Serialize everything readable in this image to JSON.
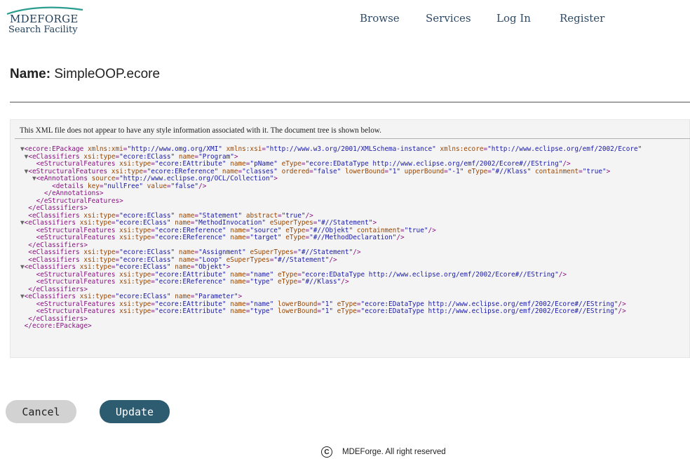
{
  "header": {
    "logo_top": "MDEFORGE",
    "logo_bottom": "Search Facility",
    "nav": [
      {
        "label": "Browse"
      },
      {
        "label": "Services"
      },
      {
        "label": "Log In"
      },
      {
        "label": "Register"
      }
    ]
  },
  "page": {
    "name_label": "Name:",
    "name_value": "SimpleOOP.ecore"
  },
  "xml_viewer": {
    "info": "This XML file does not appear to have any style information associated with it. The document tree is shown below.",
    "lines": [
      {
        "tw": "▼",
        "tok": [
          [
            "tg",
            "<ecore:EPackage "
          ],
          [
            "an",
            "xmlns:xmi"
          ],
          [
            "tg",
            "="
          ],
          [
            "av",
            "\"http://www.omg.org/XMI\""
          ],
          [
            "tg",
            " "
          ],
          [
            "an",
            "xmlns:xsi"
          ],
          [
            "tg",
            "="
          ],
          [
            "av",
            "\"http://www.w3.org/2001/XMLSchema-instance\""
          ],
          [
            "tg",
            " "
          ],
          [
            "an",
            "xmlns:ecore"
          ],
          [
            "tg",
            "="
          ],
          [
            "av",
            "\"http://www.eclipse.org/emf/2002/Ecore\""
          ]
        ]
      },
      {
        "indent": 1,
        "tw": "▼",
        "tok": [
          [
            "tg",
            "<eClassifiers "
          ],
          [
            "an",
            "xsi:type"
          ],
          [
            "tg",
            "="
          ],
          [
            "av",
            "\"ecore:EClass\""
          ],
          [
            "tg",
            " "
          ],
          [
            "an",
            "name"
          ],
          [
            "tg",
            "="
          ],
          [
            "av",
            "\"Program\""
          ],
          [
            "tg",
            ">"
          ]
        ]
      },
      {
        "indent": 2,
        "tok": [
          [
            "tg",
            "<eStructuralFeatures "
          ],
          [
            "an",
            "xsi:type"
          ],
          [
            "tg",
            "="
          ],
          [
            "av",
            "\"ecore:EAttribute\""
          ],
          [
            "tg",
            " "
          ],
          [
            "an",
            "name"
          ],
          [
            "tg",
            "="
          ],
          [
            "av",
            "\"pName\""
          ],
          [
            "tg",
            " "
          ],
          [
            "an",
            "eType"
          ],
          [
            "tg",
            "="
          ],
          [
            "av",
            "\"ecore:EDataType http://www.eclipse.org/emf/2002/Ecore#//EString\""
          ],
          [
            "tg",
            "/>"
          ]
        ]
      },
      {
        "indent": 1,
        "tw": "▼",
        "tok": [
          [
            "tg",
            "<eStructuralFeatures "
          ],
          [
            "an",
            "xsi:type"
          ],
          [
            "tg",
            "="
          ],
          [
            "av",
            "\"ecore:EReference\""
          ],
          [
            "tg",
            " "
          ],
          [
            "an",
            "name"
          ],
          [
            "tg",
            "="
          ],
          [
            "av",
            "\"classes\""
          ],
          [
            "tg",
            " "
          ],
          [
            "an",
            "ordered"
          ],
          [
            "tg",
            "="
          ],
          [
            "av",
            "\"false\""
          ],
          [
            "tg",
            " "
          ],
          [
            "an",
            "lowerBound"
          ],
          [
            "tg",
            "="
          ],
          [
            "av",
            "\"1\""
          ],
          [
            "tg",
            " "
          ],
          [
            "an",
            "upperBound"
          ],
          [
            "tg",
            "="
          ],
          [
            "av",
            "\"-1\""
          ],
          [
            "tg",
            " "
          ],
          [
            "an",
            "eType"
          ],
          [
            "tg",
            "="
          ],
          [
            "av",
            "\"#//Klass\""
          ],
          [
            "tg",
            " "
          ],
          [
            "an",
            "containment"
          ],
          [
            "tg",
            "="
          ],
          [
            "av",
            "\"true\""
          ],
          [
            "tg",
            ">"
          ]
        ]
      },
      {
        "indent": 2,
        "tw": "▼",
        "tok": [
          [
            "tg",
            "<eAnnotations "
          ],
          [
            "an",
            "source"
          ],
          [
            "tg",
            "="
          ],
          [
            "av",
            "\"http://www.eclipse.org/OCL/Collection\""
          ],
          [
            "tg",
            ">"
          ]
        ]
      },
      {
        "indent": 4,
        "tok": [
          [
            "tg",
            "<details "
          ],
          [
            "an",
            "key"
          ],
          [
            "tg",
            "="
          ],
          [
            "av",
            "\"nullFree\""
          ],
          [
            "tg",
            " "
          ],
          [
            "an",
            "value"
          ],
          [
            "tg",
            "="
          ],
          [
            "av",
            "\"false\""
          ],
          [
            "tg",
            "/>"
          ]
        ]
      },
      {
        "indent": 3,
        "tok": [
          [
            "tg",
            "</eAnnotations>"
          ]
        ]
      },
      {
        "indent": 2,
        "tok": [
          [
            "tg",
            "</eStructuralFeatures>"
          ]
        ]
      },
      {
        "indent": 1,
        "tok": [
          [
            "tg",
            "</eClassifiers>"
          ]
        ]
      },
      {
        "indent": 1,
        "tok": [
          [
            "tg",
            "<eClassifiers "
          ],
          [
            "an",
            "xsi:type"
          ],
          [
            "tg",
            "="
          ],
          [
            "av",
            "\"ecore:EClass\""
          ],
          [
            "tg",
            " "
          ],
          [
            "an",
            "name"
          ],
          [
            "tg",
            "="
          ],
          [
            "av",
            "\"Statement\""
          ],
          [
            "tg",
            " "
          ],
          [
            "an",
            "abstract"
          ],
          [
            "tg",
            "="
          ],
          [
            "av",
            "\"true\""
          ],
          [
            "tg",
            "/>"
          ]
        ]
      },
      {
        "tw": "▼",
        "tok": [
          [
            "tg",
            "<eClassifiers "
          ],
          [
            "an",
            "xsi:type"
          ],
          [
            "tg",
            "="
          ],
          [
            "av",
            "\"ecore:EClass\""
          ],
          [
            "tg",
            " "
          ],
          [
            "an",
            "name"
          ],
          [
            "tg",
            "="
          ],
          [
            "av",
            "\"MethodInvocation\""
          ],
          [
            "tg",
            " "
          ],
          [
            "an",
            "eSuperTypes"
          ],
          [
            "tg",
            "="
          ],
          [
            "av",
            "\"#//Statement\""
          ],
          [
            "tg",
            ">"
          ]
        ]
      },
      {
        "indent": 2,
        "tok": [
          [
            "tg",
            "<eStructuralFeatures "
          ],
          [
            "an",
            "xsi:type"
          ],
          [
            "tg",
            "="
          ],
          [
            "av",
            "\"ecore:EReference\""
          ],
          [
            "tg",
            " "
          ],
          [
            "an",
            "name"
          ],
          [
            "tg",
            "="
          ],
          [
            "av",
            "\"source\""
          ],
          [
            "tg",
            " "
          ],
          [
            "an",
            "eType"
          ],
          [
            "tg",
            "="
          ],
          [
            "av",
            "\"#//Objekt\""
          ],
          [
            "tg",
            " "
          ],
          [
            "an",
            "containment"
          ],
          [
            "tg",
            "="
          ],
          [
            "av",
            "\"true\""
          ],
          [
            "tg",
            "/>"
          ]
        ]
      },
      {
        "indent": 2,
        "tok": [
          [
            "tg",
            "<eStructuralFeatures "
          ],
          [
            "an",
            "xsi:type"
          ],
          [
            "tg",
            "="
          ],
          [
            "av",
            "\"ecore:EReference\""
          ],
          [
            "tg",
            " "
          ],
          [
            "an",
            "name"
          ],
          [
            "tg",
            "="
          ],
          [
            "av",
            "\"target\""
          ],
          [
            "tg",
            " "
          ],
          [
            "an",
            "eType"
          ],
          [
            "tg",
            "="
          ],
          [
            "av",
            "\"#//MethodDeclaration\""
          ],
          [
            "tg",
            "/>"
          ]
        ]
      },
      {
        "indent": 1,
        "tok": [
          [
            "tg",
            "</eClassifiers>"
          ]
        ]
      },
      {
        "indent": 1,
        "tok": [
          [
            "tg",
            "<eClassifiers "
          ],
          [
            "an",
            "xsi:type"
          ],
          [
            "tg",
            "="
          ],
          [
            "av",
            "\"ecore:EClass\""
          ],
          [
            "tg",
            " "
          ],
          [
            "an",
            "name"
          ],
          [
            "tg",
            "="
          ],
          [
            "av",
            "\"Assignment\""
          ],
          [
            "tg",
            " "
          ],
          [
            "an",
            "eSuperTypes"
          ],
          [
            "tg",
            "="
          ],
          [
            "av",
            "\"#//Statement\""
          ],
          [
            "tg",
            "/>"
          ]
        ]
      },
      {
        "indent": 1,
        "tok": [
          [
            "tg",
            "<eClassifiers "
          ],
          [
            "an",
            "xsi:type"
          ],
          [
            "tg",
            "="
          ],
          [
            "av",
            "\"ecore:EClass\""
          ],
          [
            "tg",
            " "
          ],
          [
            "an",
            "name"
          ],
          [
            "tg",
            "="
          ],
          [
            "av",
            "\"Loop\""
          ],
          [
            "tg",
            " "
          ],
          [
            "an",
            "eSuperTypes"
          ],
          [
            "tg",
            "="
          ],
          [
            "av",
            "\"#//Statement\""
          ],
          [
            "tg",
            "/>"
          ]
        ]
      },
      {
        "tw": "▼",
        "tok": [
          [
            "tg",
            "<eClassifiers "
          ],
          [
            "an",
            "xsi:type"
          ],
          [
            "tg",
            "="
          ],
          [
            "av",
            "\"ecore:EClass\""
          ],
          [
            "tg",
            " "
          ],
          [
            "an",
            "name"
          ],
          [
            "tg",
            "="
          ],
          [
            "av",
            "\"Objekt\""
          ],
          [
            "tg",
            ">"
          ]
        ]
      },
      {
        "indent": 2,
        "tok": [
          [
            "tg",
            "<eStructuralFeatures "
          ],
          [
            "an",
            "xsi:type"
          ],
          [
            "tg",
            "="
          ],
          [
            "av",
            "\"ecore:EAttribute\""
          ],
          [
            "tg",
            " "
          ],
          [
            "an",
            "name"
          ],
          [
            "tg",
            "="
          ],
          [
            "av",
            "\"name\""
          ],
          [
            "tg",
            " "
          ],
          [
            "an",
            "eType"
          ],
          [
            "tg",
            "="
          ],
          [
            "av",
            "\"ecore:EDataType http://www.eclipse.org/emf/2002/Ecore#//EString\""
          ],
          [
            "tg",
            "/>"
          ]
        ]
      },
      {
        "indent": 2,
        "tok": [
          [
            "tg",
            "<eStructuralFeatures "
          ],
          [
            "an",
            "xsi:type"
          ],
          [
            "tg",
            "="
          ],
          [
            "av",
            "\"ecore:EReference\""
          ],
          [
            "tg",
            " "
          ],
          [
            "an",
            "name"
          ],
          [
            "tg",
            "="
          ],
          [
            "av",
            "\"type\""
          ],
          [
            "tg",
            " "
          ],
          [
            "an",
            "eType"
          ],
          [
            "tg",
            "="
          ],
          [
            "av",
            "\"#//Klass\""
          ],
          [
            "tg",
            "/>"
          ]
        ]
      },
      {
        "indent": 1,
        "tok": [
          [
            "tg",
            "</eClassifiers>"
          ]
        ]
      },
      {
        "tw": "▼",
        "tok": [
          [
            "tg",
            "<eClassifiers "
          ],
          [
            "an",
            "xsi:type"
          ],
          [
            "tg",
            "="
          ],
          [
            "av",
            "\"ecore:EClass\""
          ],
          [
            "tg",
            " "
          ],
          [
            "an",
            "name"
          ],
          [
            "tg",
            "="
          ],
          [
            "av",
            "\"Parameter\""
          ],
          [
            "tg",
            ">"
          ]
        ]
      },
      {
        "indent": 2,
        "tok": [
          [
            "tg",
            "<eStructuralFeatures "
          ],
          [
            "an",
            "xsi:type"
          ],
          [
            "tg",
            "="
          ],
          [
            "av",
            "\"ecore:EAttribute\""
          ],
          [
            "tg",
            " "
          ],
          [
            "an",
            "name"
          ],
          [
            "tg",
            "="
          ],
          [
            "av",
            "\"name\""
          ],
          [
            "tg",
            " "
          ],
          [
            "an",
            "lowerBound"
          ],
          [
            "tg",
            "="
          ],
          [
            "av",
            "\"1\""
          ],
          [
            "tg",
            " "
          ],
          [
            "an",
            "eType"
          ],
          [
            "tg",
            "="
          ],
          [
            "av",
            "\"ecore:EDataType http://www.eclipse.org/emf/2002/Ecore#//EString\""
          ],
          [
            "tg",
            "/>"
          ]
        ]
      },
      {
        "indent": 2,
        "tok": [
          [
            "tg",
            "<eStructuralFeatures "
          ],
          [
            "an",
            "xsi:type"
          ],
          [
            "tg",
            "="
          ],
          [
            "av",
            "\"ecore:EAttribute\""
          ],
          [
            "tg",
            " "
          ],
          [
            "an",
            "name"
          ],
          [
            "tg",
            "="
          ],
          [
            "av",
            "\"type\""
          ],
          [
            "tg",
            " "
          ],
          [
            "an",
            "lowerBound"
          ],
          [
            "tg",
            "="
          ],
          [
            "av",
            "\"1\""
          ],
          [
            "tg",
            " "
          ],
          [
            "an",
            "eType"
          ],
          [
            "tg",
            "="
          ],
          [
            "av",
            "\"ecore:EDataType http://www.eclipse.org/emf/2002/Ecore#//EString\""
          ],
          [
            "tg",
            "/>"
          ]
        ]
      },
      {
        "indent": 1,
        "tok": [
          [
            "tg",
            "</eClassifiers>"
          ]
        ]
      },
      {
        "tok": [
          [
            "tg",
            "</ecore:EPackage>"
          ]
        ]
      }
    ]
  },
  "actions": {
    "cancel_label": "Cancel",
    "update_label": "Update"
  },
  "footer": {
    "copyright_symbol": "C",
    "text": "MDEForge. All right reserved"
  }
}
